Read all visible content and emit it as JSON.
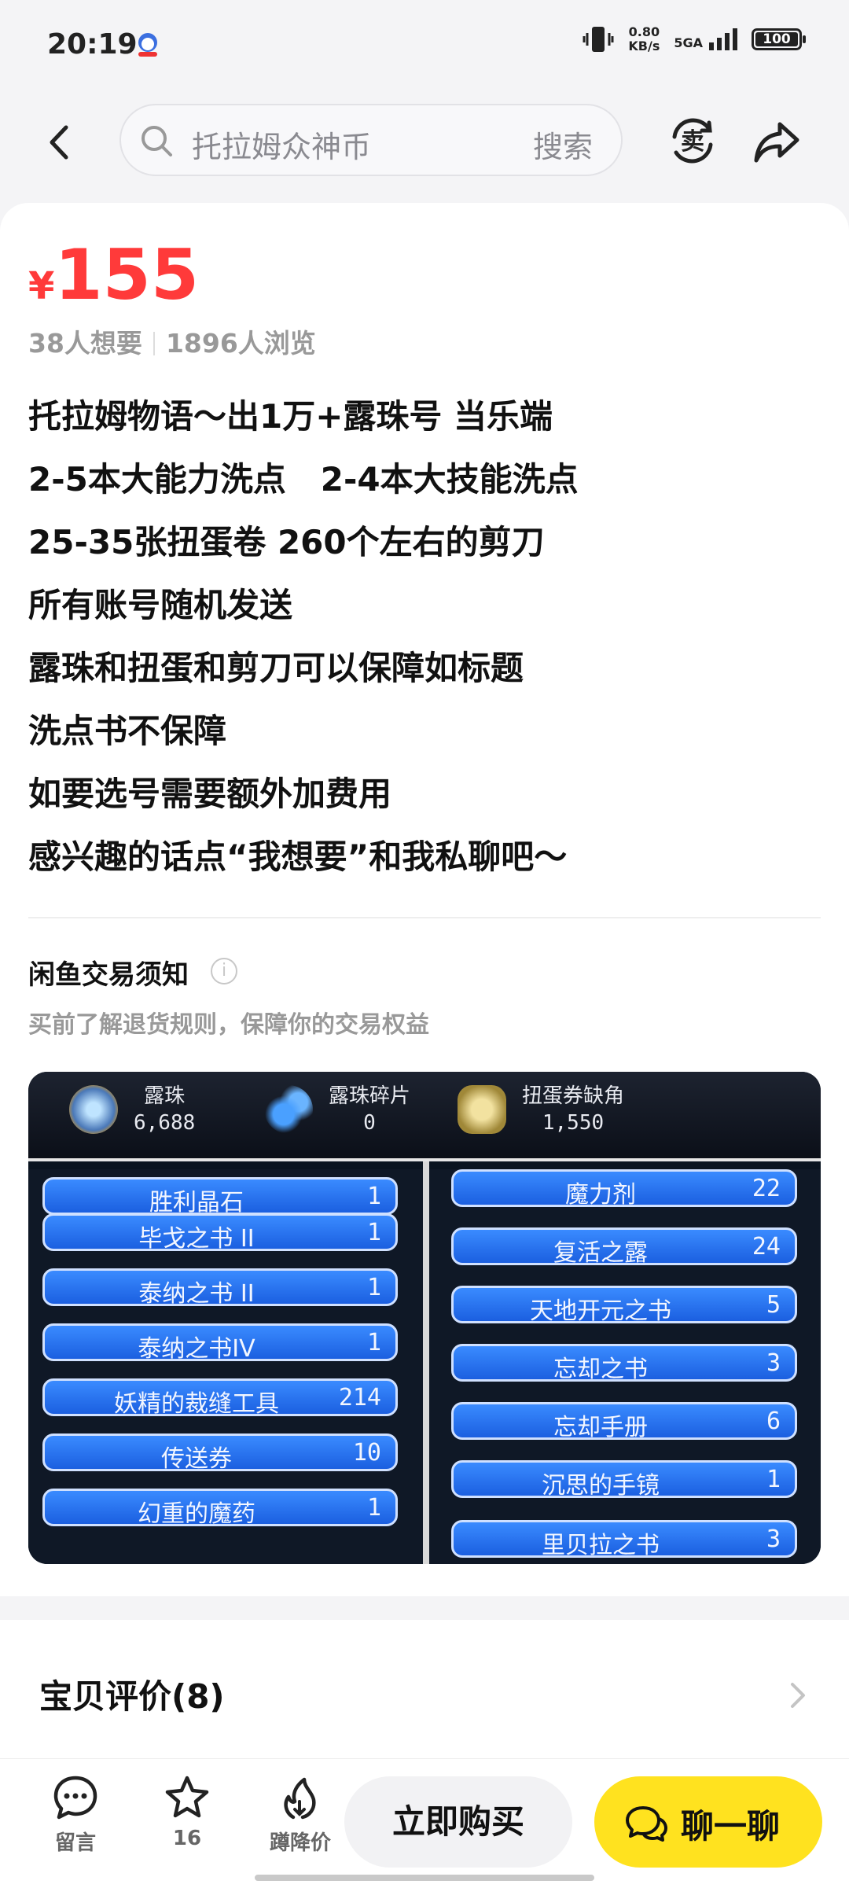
{
  "status": {
    "time": "20:19",
    "net_speed": "0.80",
    "net_unit": "KB/s",
    "network": "5GA",
    "battery": "100"
  },
  "header": {
    "search_placeholder": "托拉姆众神币",
    "search_button": "搜索",
    "sell_icon": "sell-icon",
    "share_icon": "share-icon"
  },
  "product": {
    "currency": "¥",
    "price": "155",
    "wants": "38人想要",
    "views": "1896人浏览",
    "description": [
      "托拉姆物语～出1万+露珠号 当乐端",
      "2-5本大能力洗点   2-4本大技能洗点",
      "25-35张扭蛋卷 260个左右的剪刀",
      "所有账号随机发送",
      "露珠和扭蛋和剪刀可以保障如标题",
      "洗点书不保障",
      "如要选号需要额外加费用",
      "感兴趣的话点“我想要”和我私聊吧～"
    ]
  },
  "notice": {
    "title": "闲鱼交易须知",
    "subtitle": "买前了解退货规则，保障你的交易权益"
  },
  "game_image": {
    "resources": [
      {
        "name": "露珠",
        "value": "6,688"
      },
      {
        "name": "露珠碎片",
        "value": "0"
      },
      {
        "name": "扭蛋券缺角",
        "value": "1,550"
      }
    ],
    "left_items": [
      {
        "name": "胜利晶石",
        "count": "1"
      },
      {
        "name": "毕戈之书 II",
        "count": "1"
      },
      {
        "name": "泰纳之书 II",
        "count": "1"
      },
      {
        "name": "泰纳之书IV",
        "count": "1"
      },
      {
        "name": "妖精的裁缝工具",
        "count": "214"
      },
      {
        "name": "传送券",
        "count": "10"
      },
      {
        "name": "幻重的魔药",
        "count": "1"
      }
    ],
    "right_items": [
      {
        "name": "魔力剂",
        "count": "22"
      },
      {
        "name": "复活之露",
        "count": "24"
      },
      {
        "name": "天地开元之书",
        "count": "5"
      },
      {
        "name": "忘却之书",
        "count": "3"
      },
      {
        "name": "忘却手册",
        "count": "6"
      },
      {
        "name": "沉思的手镜",
        "count": "1"
      },
      {
        "name": "里贝拉之书",
        "count": "3"
      }
    ]
  },
  "reviews": {
    "title": "宝贝评价(8)"
  },
  "bottom": {
    "comment_label": "留言",
    "favorite_count": "16",
    "price_drop_label": "蹲降价",
    "buy_label": "立即购买",
    "chat_label": "聊一聊"
  }
}
